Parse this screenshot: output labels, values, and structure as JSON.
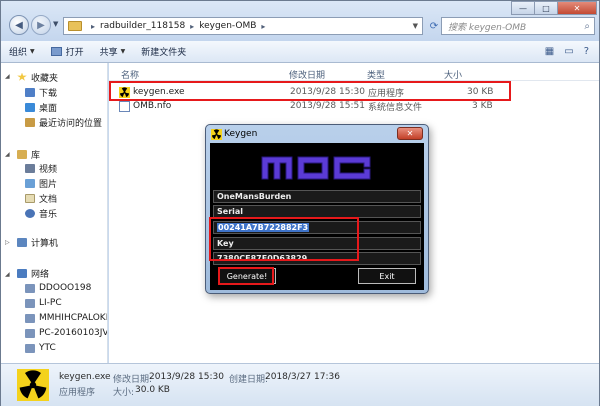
{
  "address": {
    "crumbs": [
      "radbuilder_118158",
      "keygen-OMB"
    ],
    "search_placeholder": "搜索 keygen-OMB"
  },
  "window_controls": {
    "minimize": "—",
    "maximize": "□",
    "close": "✕"
  },
  "toolbar": {
    "organize": "组织",
    "open": "打开",
    "share": "共享",
    "new_folder": "新建文件夹"
  },
  "sidebar": {
    "favorites_header": "收藏夹",
    "favorites": [
      "下载",
      "桌面",
      "最近访问的位置"
    ],
    "library_header": "库",
    "library": [
      "视频",
      "图片",
      "文档",
      "音乐"
    ],
    "computer": "计算机",
    "network_header": "网络",
    "network": [
      "DDOOO198",
      "LI-PC",
      "MMHIHCPALOKNI",
      "PC-20160103JVOB",
      "YTC"
    ]
  },
  "columns": {
    "name": "名称",
    "date": "修改日期",
    "type": "类型",
    "size": "大小"
  },
  "files": [
    {
      "name": "keygen.exe",
      "date": "2013/9/28 15:30",
      "type": "应用程序",
      "size": "30 KB"
    },
    {
      "name": "OMB.nfo",
      "date": "2013/9/28 15:51",
      "type": "系统信息文件",
      "size": "3 KB"
    }
  ],
  "status": {
    "name": "keygen.exe",
    "modified_label": "修改日期:",
    "modified": "2013/9/28 15:30",
    "created_label": "创建日期:",
    "created": "2018/3/27 17:36",
    "kind": "应用程序",
    "size_label": "大小:",
    "size": "30.0 KB"
  },
  "keygen": {
    "title": "Keygen",
    "close": "✕",
    "name_value": "OneMansBurden",
    "serial_label": "Serial",
    "serial_value": "00241A7B722882F3",
    "key_label": "Key",
    "key_value": "7380CE87F0D63829",
    "generate": "Generate!",
    "exit": "Exit"
  },
  "colors": {
    "highlight": "#e6191b",
    "selection": "#3e73c9",
    "logo": "#5b3bd6"
  }
}
